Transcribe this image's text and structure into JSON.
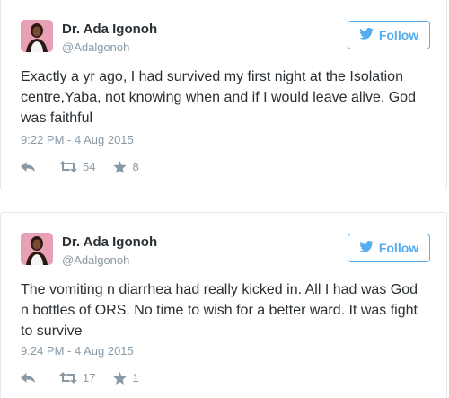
{
  "colors": {
    "twitter_blue": "#55acee",
    "text": "#292f33",
    "muted": "#8899a6",
    "border": "#e1e8ed",
    "avatar_bg": "#e8a0b4"
  },
  "tweets": [
    {
      "display_name": "Dr. Ada Igonoh",
      "handle": "@Adalgonoh",
      "follow_label": "Follow",
      "text": "Exactly a yr ago, I had survived my first night at the Isolation centre,Yaba, not knowing when and if I would leave alive. God was faithful",
      "timestamp": "9:22 PM - 4 Aug 2015",
      "retweets": "54",
      "favorites": "8"
    },
    {
      "display_name": "Dr. Ada Igonoh",
      "handle": "@Adalgonoh",
      "follow_label": "Follow",
      "text": "The vomiting n diarrhea had really kicked in. All I had was God n bottles of ORS. No time to wish for a better ward. It was fight to survive",
      "timestamp": "9:24 PM - 4 Aug 2015",
      "retweets": "17",
      "favorites": "1"
    }
  ],
  "icons": {
    "follow": "twitter-bird-icon",
    "reply": "reply-icon",
    "retweet": "retweet-icon",
    "favorite": "star-icon"
  }
}
